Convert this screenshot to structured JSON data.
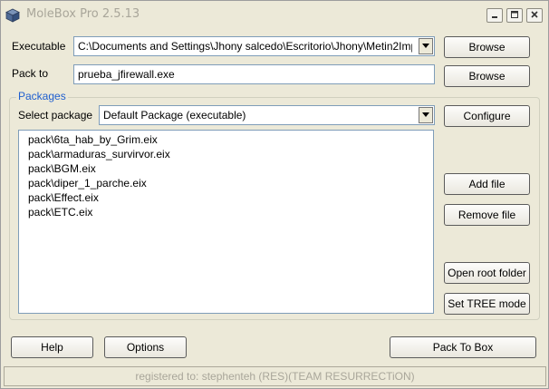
{
  "window": {
    "title": "MoleBox Pro 2.5.13",
    "icon": "cube-icon",
    "controls": [
      "minimize-icon",
      "maximize-icon",
      "close-icon"
    ]
  },
  "executable": {
    "label": "Executable",
    "value": "C:\\Documents and Settings\\Jhony salcedo\\Escritorio\\Jhony\\Metin2Imp",
    "browse_label": "Browse"
  },
  "pack_to": {
    "label": "Pack to",
    "value": "prueba_jfirewall.exe",
    "browse_label": "Browse"
  },
  "packages": {
    "group_title": "Packages",
    "select_label": "Select package",
    "selected": "Default Package (executable)",
    "configure_label": "Configure",
    "files": [
      "pack\\6ta_hab_by_Grim.eix",
      "pack\\armaduras_survirvor.eix",
      "pack\\BGM.eix",
      "pack\\diper_1_parche.eix",
      "pack\\Effect.eix",
      "pack\\ETC.eix"
    ],
    "add_file_label": "Add file",
    "remove_file_label": "Remove file",
    "open_root_label": "Open root folder",
    "set_tree_label": "Set TREE mode"
  },
  "footer": {
    "help_label": "Help",
    "options_label": "Options",
    "pack_label": "Pack To Box"
  },
  "status": {
    "text": "registered to: stephenteh (RES)(TEAM RESURRECTiON)"
  }
}
